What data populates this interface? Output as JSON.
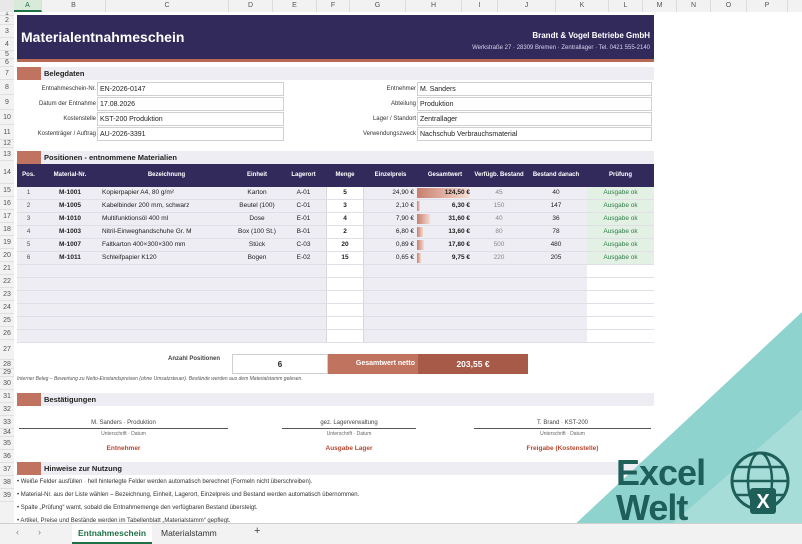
{
  "columns": [
    "A",
    "B",
    "C",
    "D",
    "E",
    "F",
    "G",
    "H",
    "I",
    "J",
    "K",
    "L",
    "M",
    "N",
    "O",
    "P"
  ],
  "rows": [
    "1",
    "2",
    "3",
    "4",
    "5",
    "6",
    "7",
    "8",
    "9",
    "10",
    "11",
    "12",
    "13",
    "14",
    "15",
    "16",
    "17",
    "18",
    "19",
    "20",
    "21",
    "22",
    "23",
    "24",
    "25",
    "26",
    "27",
    "28",
    "29",
    "30",
    "31",
    "32",
    "33",
    "34",
    "35",
    "36",
    "37",
    "38",
    "39"
  ],
  "banner": {
    "title": "Materialentnahmeschein",
    "company": "Brandt & Vogel Betriebe GmbH",
    "address": "Werkstraße 27 · 28309 Bremen  ·  Zentrallager · Tel. 0421 555-2140"
  },
  "belegdaten": {
    "heading": "Belegdaten",
    "left": [
      {
        "label": "Entnahmeschein-Nr.",
        "value": "EN-2026-0147"
      },
      {
        "label": "Datum der Entnahme",
        "value": "17.08.2026"
      },
      {
        "label": "Kostenstelle",
        "value": "KST-200 Produktion"
      },
      {
        "label": "Kostenträger / Auftrag",
        "value": "AU-2026-3391"
      }
    ],
    "right": [
      {
        "label": "Entnehmer",
        "value": "M. Sanders"
      },
      {
        "label": "Abteilung",
        "value": "Produktion"
      },
      {
        "label": "Lager / Standort",
        "value": "Zentrallager"
      },
      {
        "label": "Verwendungszweck",
        "value": "Nachschub Verbrauchsmaterial"
      }
    ]
  },
  "positionen": {
    "heading": "Positionen - entnommene Materialien",
    "headers": [
      "Pos.",
      "Material-Nr.",
      "Bezeichnung",
      "Einheit",
      "Lagerort",
      "Menge",
      "Einzelpreis",
      "Gesamtwert",
      "Verfügb. Bestand",
      "Bestand danach",
      "Prüfung"
    ],
    "rows": [
      {
        "pos": "1",
        "nr": "M-1001",
        "bez": "Kopierpapier A4, 80 g/m²",
        "einheit": "Karton",
        "ort": "A-01",
        "menge": "5",
        "preis": "24,90 €",
        "gesamt": "124,50 €",
        "verf": "45",
        "danach": "40",
        "pruef": "Ausgabe ok",
        "share": 1.0
      },
      {
        "pos": "2",
        "nr": "M-1005",
        "bez": "Kabelbinder 200 mm, schwarz",
        "einheit": "Beutel (100)",
        "ort": "C-01",
        "menge": "3",
        "preis": "2,10 €",
        "gesamt": "6,30 €",
        "verf": "150",
        "danach": "147",
        "pruef": "Ausgabe ok",
        "share": 0.05
      },
      {
        "pos": "3",
        "nr": "M-1010",
        "bez": "Multifunktionsöl 400 ml",
        "einheit": "Dose",
        "ort": "E-01",
        "menge": "4",
        "preis": "7,90 €",
        "gesamt": "31,60 €",
        "verf": "40",
        "danach": "36",
        "pruef": "Ausgabe ok",
        "share": 0.25
      },
      {
        "pos": "4",
        "nr": "M-1003",
        "bez": "Nitril-Einweghandschuhe Gr. M",
        "einheit": "Box (100 St.)",
        "ort": "B-01",
        "menge": "2",
        "preis": "6,80 €",
        "gesamt": "13,60 €",
        "verf": "80",
        "danach": "78",
        "pruef": "Ausgabe ok",
        "share": 0.11
      },
      {
        "pos": "5",
        "nr": "M-1007",
        "bez": "Faltkarton 400×300×300 mm",
        "einheit": "Stück",
        "ort": "C-03",
        "menge": "20",
        "preis": "0,89 €",
        "gesamt": "17,80 €",
        "verf": "500",
        "danach": "480",
        "pruef": "Ausgabe ok",
        "share": 0.14
      },
      {
        "pos": "6",
        "nr": "M-1011",
        "bez": "Schleifpapier K120",
        "einheit": "Bogen",
        "ort": "E-02",
        "menge": "15",
        "preis": "0,65 €",
        "gesamt": "9,75 €",
        "verf": "220",
        "danach": "205",
        "pruef": "Ausgabe ok",
        "share": 0.08
      }
    ],
    "empty_rows": 6
  },
  "totals": {
    "count_label": "Anzahl Positionen",
    "count": "6",
    "net_label": "Gesamtwert netto",
    "net_value": "203,55 €"
  },
  "note": "Interner Beleg – Bewertung zu Netto-Einstandspreisen (ohne Umsatzsteuer). Bestände werden aus dem Materialstamm gelesen.",
  "bestaetigungen": {
    "heading": "Bestätigungen",
    "signatures": [
      {
        "name": "M. Sanders · Produktion",
        "sub": "Unterschrift · Datum",
        "role": "Entnehmer"
      },
      {
        "name": "gez. Lagerverwaltung",
        "sub": "Unterschrift · Datum",
        "role": "Ausgabe Lager"
      },
      {
        "name": "T. Brand · KST-200",
        "sub": "Unterschrift · Datum",
        "role": "Freigabe (Kostenstelle)"
      }
    ]
  },
  "hinweise": {
    "heading": "Hinweise zur Nutzung",
    "items": [
      "• Weiße Felder ausfüllen · hell hinterlegte Felder werden automatisch berechnet (Formeln nicht überschreiben).",
      "• Material-Nr. aus der Liste wählen – Bezeichnung, Einheit, Lagerort, Einzelpreis und Bestand werden automatisch übernommen.",
      "• Spalte „Prüfung“ warnt, sobald die Entnahmemenge den verfügbaren Bestand übersteigt.",
      "• Artikel, Preise und Bestände werden im Tabellenblatt „Materialstamm“ gepflegt."
    ]
  },
  "tabs": {
    "prev": "‹",
    "next": "›",
    "sheets": [
      "Entnahmeschein",
      "Materialstamm"
    ],
    "add": "+"
  },
  "logo": {
    "line1": "Excel",
    "line2": "Welt",
    "badge": "X"
  },
  "colors": {
    "navy": "#332a5c",
    "accent": "#c0735f",
    "ok_green": "#2e7d46",
    "logo_teal": "#1f5f5a"
  }
}
